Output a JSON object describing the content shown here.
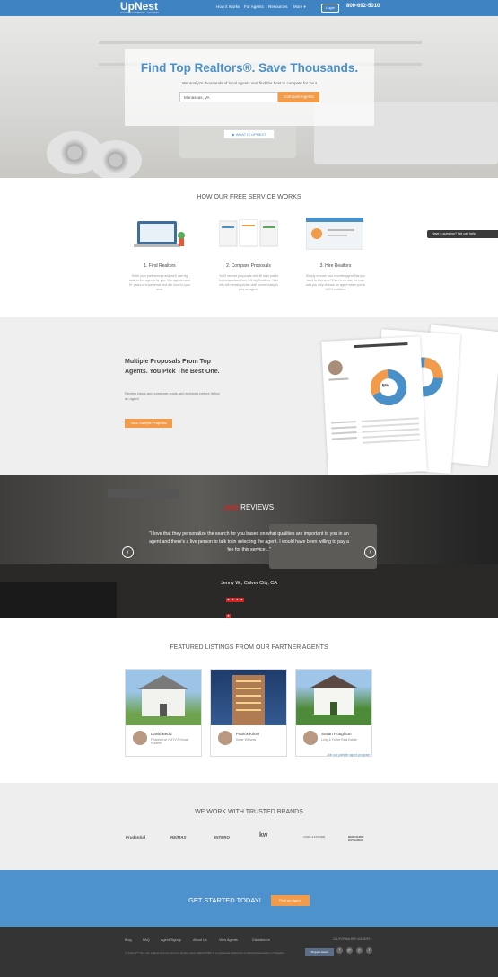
{
  "nav": {
    "logo": "UpNest",
    "logo_tag": "AGENTS COMPETE. YOU WIN.",
    "links": [
      "How it Works",
      "For Agents",
      "Resources",
      "More ▾"
    ],
    "login": "Login",
    "phone": "800-692-5010",
    "bg_color": "#3f83c2"
  },
  "hero": {
    "title": "Find Top Realtors®. Save Thousands.",
    "subtitle": "We analyze thousands of local agents and find the best to compete for you!",
    "location_value": "Manassas, VA",
    "compare_button": "Compare Agents",
    "what_button": "▶  WHAT IS UPNEST"
  },
  "how": {
    "title": "HOW OUR FREE SERVICE WORKS",
    "steps": [
      {
        "title": "1. Find Realtors",
        "text": "Enter your preferences and we'll use big data to find agents for you. Our agents have 5+ years of experience and are local to your area."
      },
      {
        "title": "2. Compare Proposals",
        "text": "You'll receive proposals with fill data points for comparison from 3-5 top Realtors. Your info will remain private until you're ready to pick an agent."
      },
      {
        "title": "3. Hire Realtors",
        "text": "Simply choose your favorite agent that you want to interview! There's no risk, no cost, and you only choose an agent when you're 100% satisfied."
      }
    ]
  },
  "help_tab": "Have a question? We can help.",
  "proposals": {
    "title": "Multiple Proposals From Top Agents. You Pick The Best One.",
    "text": "Review plans and compare costs and services before hiring an agent",
    "button": "View Sample Proposal",
    "pie_label": "5%"
  },
  "reviews": {
    "yelp": "yelp",
    "heading": "REVIEWS",
    "quote": "\"I love that they personalize the search for you based on what qualities are important to you in an agent and there's a live person to talk to in selecting the agent. I would have been willing to pay a fee for this service...\"",
    "reviewer": "Jenny W., Culver City, CA",
    "rating": 5,
    "prev": "‹",
    "next": "›"
  },
  "listings": {
    "title": "FEATURED LISTINGS FROM OUR PARTNER AGENTS",
    "cards": [
      {
        "name": "David Bediz",
        "company": "Featured on HGTV'S House Hunters"
      },
      {
        "name": "Patrick Kilner",
        "company": "Keller Williams"
      },
      {
        "name": "Susan Houghton",
        "company": "Long & Foster Real Estate"
      }
    ],
    "join_link": "Join our partner agent program"
  },
  "brands": {
    "title": "WE WORK WITH TRUSTED BRANDS",
    "items": [
      "Prudential",
      "RE/MAX",
      "INTERO",
      "kw",
      "LONG & FOSTER",
      "BERKSHIRE HATHAWAY"
    ]
  },
  "cta": {
    "text": "GET STARTED TODAY!",
    "button": "Find an Agent"
  },
  "footer": {
    "links": [
      "Blog",
      "FAQ",
      "Agent Signup",
      "About Us",
      "View Agents",
      "Disclaimers"
    ],
    "copyright": "© UpNest™ Inc. Use subject to terms and our privacy policy. REALTOR® is a registered trademark of National Association of Realtors.",
    "license": "CALIFORNIA BRE #01852973",
    "social": [
      "f",
      "g+",
      "p",
      "t"
    ],
    "badge": "Shopper Award"
  }
}
